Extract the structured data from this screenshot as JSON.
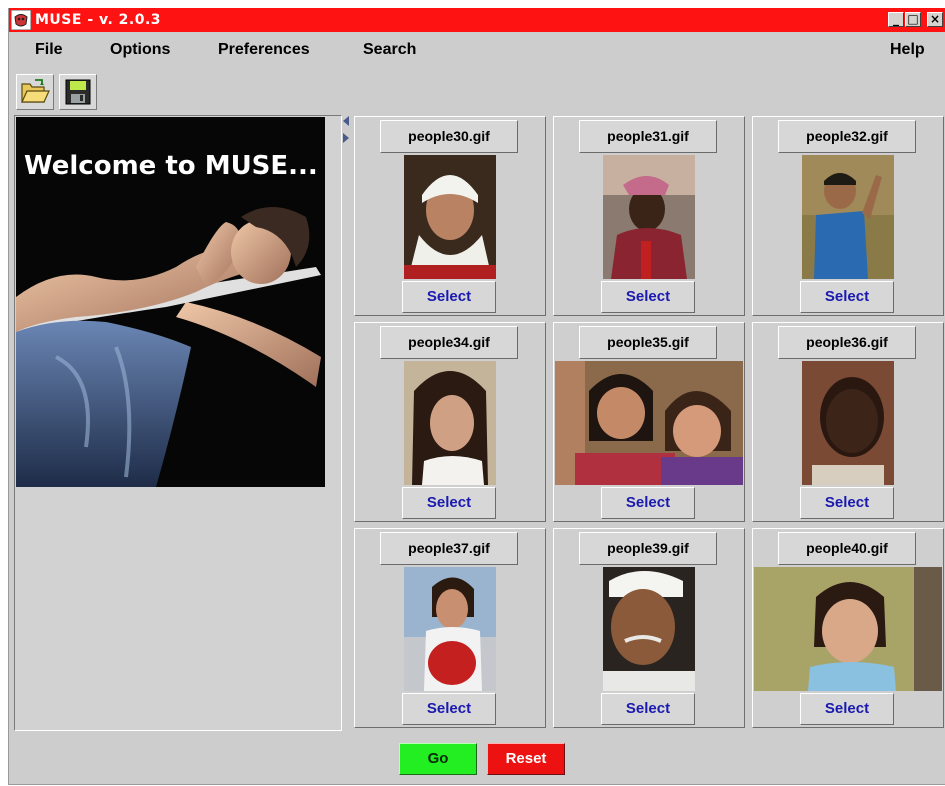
{
  "window": {
    "title": "MUSE - v. 2.0.3",
    "controls": {
      "minimize": "_",
      "maximize": "□",
      "close": "×"
    },
    "colors": {
      "titlebar": "#ff1212",
      "background": "#cdcdcd"
    }
  },
  "menubar": {
    "items": [
      "File",
      "Options",
      "Preferences",
      "Search"
    ],
    "help": "Help"
  },
  "toolbar": {
    "buttons": [
      {
        "icon": "open-folder-icon"
      },
      {
        "icon": "save-disk-icon"
      }
    ]
  },
  "splash": {
    "text": "Welcome to MUSE..."
  },
  "images": [
    {
      "filename": "people30.gif",
      "select": "Select"
    },
    {
      "filename": "people31.gif",
      "select": "Select"
    },
    {
      "filename": "people32.gif",
      "select": "Select"
    },
    {
      "filename": "people34.gif",
      "select": "Select"
    },
    {
      "filename": "people35.gif",
      "select": "Select"
    },
    {
      "filename": "people36.gif",
      "select": "Select"
    },
    {
      "filename": "people37.gif",
      "select": "Select"
    },
    {
      "filename": "people39.gif",
      "select": "Select"
    },
    {
      "filename": "people40.gif",
      "select": "Select"
    }
  ],
  "actions": {
    "go": "Go",
    "reset": "Reset",
    "colors": {
      "go": "#22ee22",
      "reset": "#ee1111"
    }
  }
}
